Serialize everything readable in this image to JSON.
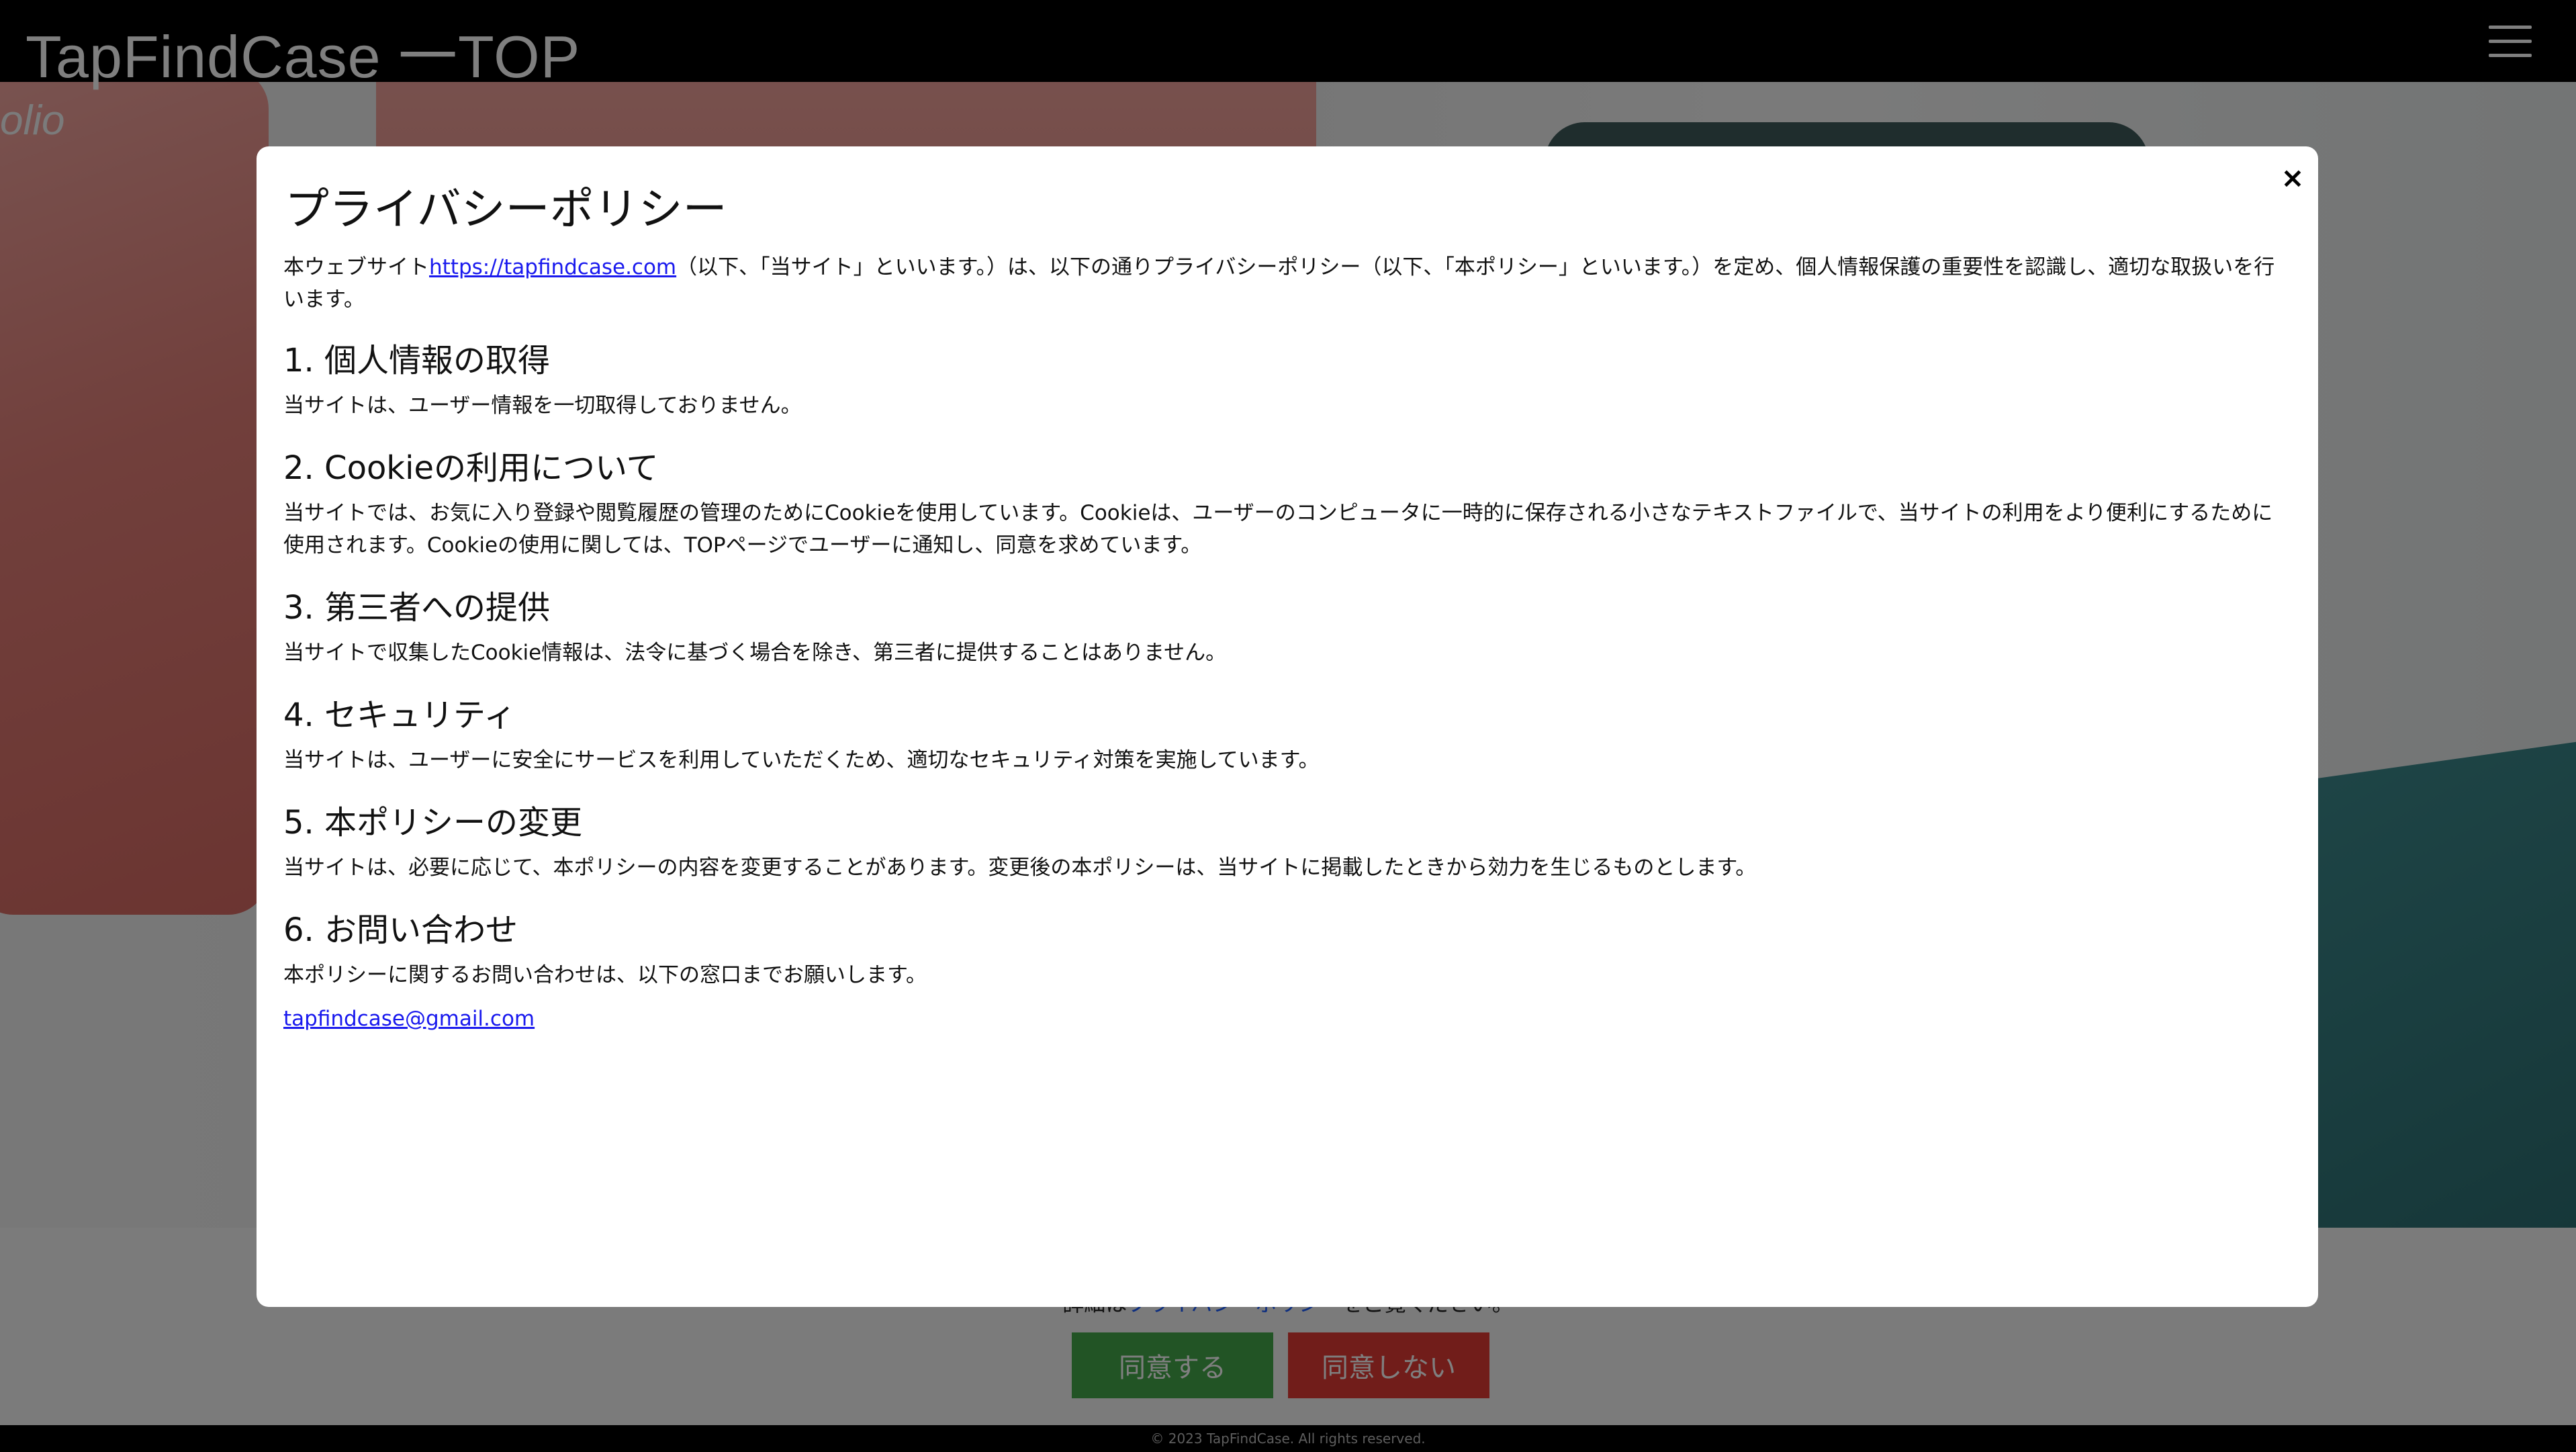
{
  "header": {
    "site_title": "TapFindCase 一TOP"
  },
  "hero": {
    "logo_fragment": "olio"
  },
  "consent": {
    "text_prefix": "詳細は",
    "policy_link": "プライバシーポリシー",
    "text_suffix": "をご覧ください。",
    "agree_label": "同意する",
    "disagree_label": "同意しない"
  },
  "footer": {
    "copyright": "© 2023 TapFindCase. All rights reserved."
  },
  "modal": {
    "close_label": "×",
    "title": "プライバシーポリシー",
    "intro_prefix": "本ウェブサイト",
    "intro_link": "https://tapfindcase.com",
    "intro_suffix": "（以下、「当サイト」といいます。）は、以下の通りプライバシーポリシー（以下、「本ポリシー」といいます。）を定め、個人情報保護の重要性を認識し、適切な取扱いを行います。",
    "sections": [
      {
        "heading": "1. 個人情報の取得",
        "body": "当サイトは、ユーザー情報を一切取得しておりません。"
      },
      {
        "heading": "2. Cookieの利用について",
        "body": "当サイトでは、お気に入り登録や閲覧履歴の管理のためにCookieを使用しています。Cookieは、ユーザーのコンピュータに一時的に保存される小さなテキストファイルで、当サイトの利用をより便利にするために使用されます。Cookieの使用に関しては、TOPページでユーザーに通知し、同意を求めています。"
      },
      {
        "heading": "3. 第三者への提供",
        "body": "当サイトで収集したCookie情報は、法令に基づく場合を除き、第三者に提供することはありません。"
      },
      {
        "heading": "4. セキュリティ",
        "body": "当サイトは、ユーザーに安全にサービスを利用していただくため、適切なセキュリティ対策を実施しています。"
      },
      {
        "heading": "5. 本ポリシーの変更",
        "body": "当サイトは、必要に応じて、本ポリシーの内容を変更することがあります。変更後の本ポリシーは、当サイトに掲載したときから効力を生じるものとします。"
      },
      {
        "heading": "6. お問い合わせ",
        "body": "本ポリシーに関するお問い合わせは、以下の窓口までお願いします。"
      }
    ],
    "contact_email": "tapfindcase@gmail.com"
  }
}
